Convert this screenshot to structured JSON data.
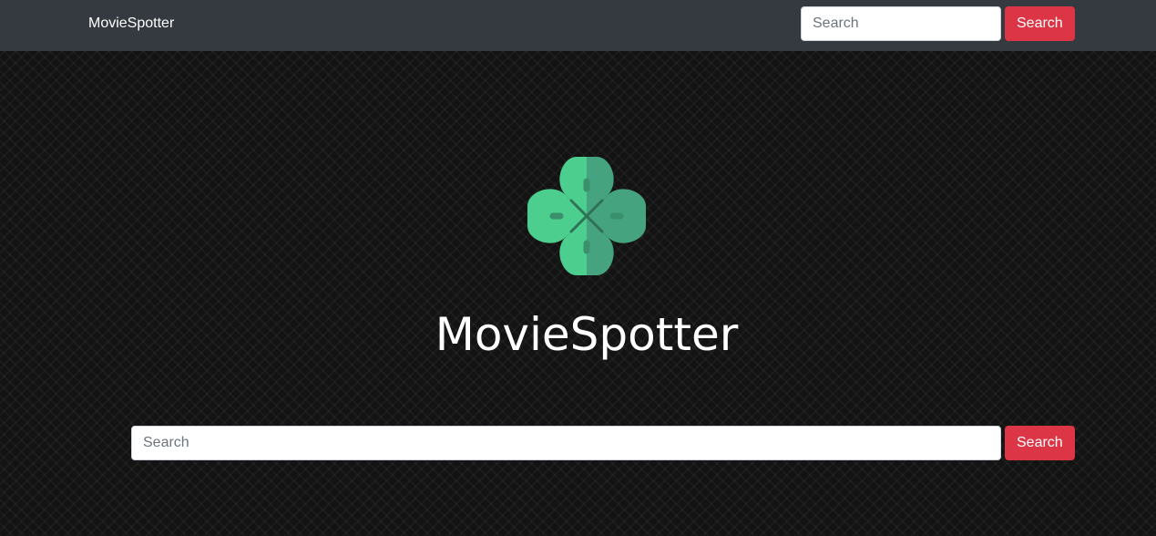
{
  "navbar": {
    "brand": "MovieSpotter",
    "search": {
      "placeholder": "Search",
      "button_label": "Search"
    }
  },
  "hero": {
    "logo_icon": "four-leaf-clover-icon",
    "title": "MovieSpotter"
  },
  "main_search": {
    "placeholder": "Search",
    "button_label": "Search"
  },
  "colors": {
    "navbar_bg": "#343a40",
    "page_bg": "#131313",
    "button_danger": "#dc3545",
    "clover_light": "#4ccf8e",
    "clover_dark": "#45a47f"
  }
}
